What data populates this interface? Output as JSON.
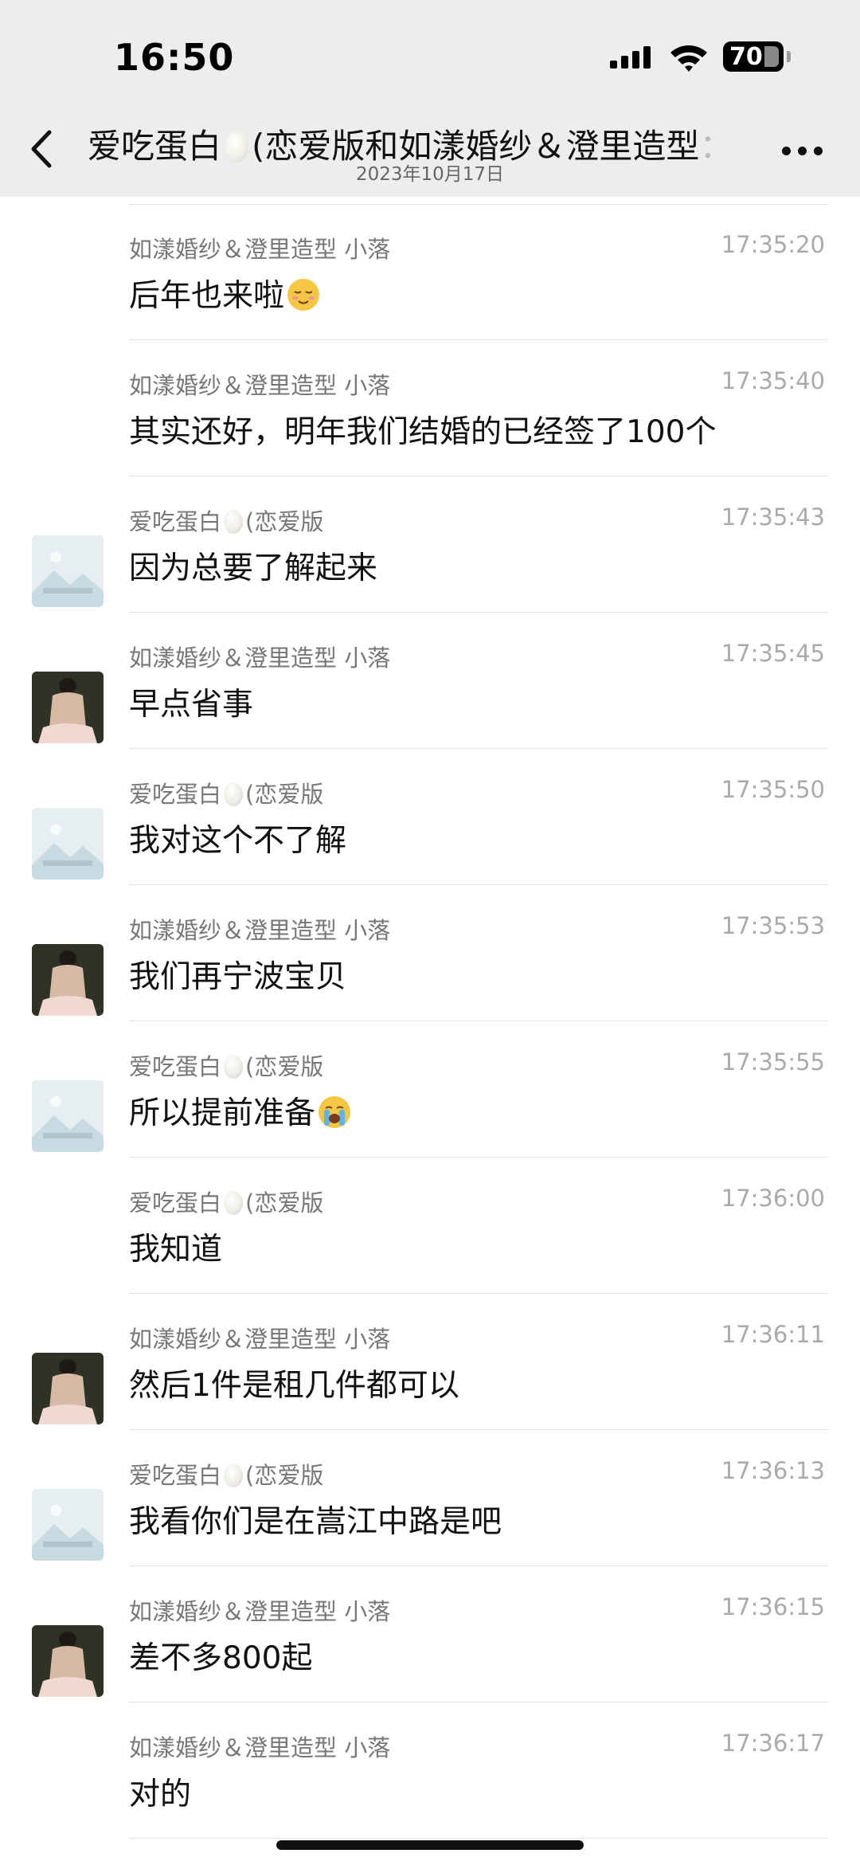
{
  "status_bar": {
    "time": "16:50",
    "battery": "70"
  },
  "header": {
    "title_pre": "爱吃蛋白",
    "title_post": "(恋爱版和如漾婚纱＆澄里造型",
    "title_cut": "：",
    "date": "2023年10月17日",
    "back_icon": "chevron-left-icon",
    "more_icon": "ellipsis-icon"
  },
  "names": {
    "me": "如漾婚纱＆澄里造型 小落",
    "her": "(恋爱版",
    "her_pre": "爱吃蛋白"
  },
  "messages": [
    {
      "sender": "me",
      "time": "17:35:20",
      "text": "后年也来啦",
      "emoji": "embarrassed-smile-emoji",
      "avatar": "none"
    },
    {
      "sender": "me",
      "time": "17:35:40",
      "text": "其实还好，明年我们结婚的已经签了100个",
      "avatar": "none"
    },
    {
      "sender": "her",
      "time": "17:35:43",
      "text": "因为总要了解起来",
      "avatar": "placeholder"
    },
    {
      "sender": "me",
      "time": "17:35:45",
      "text": "早点省事",
      "avatar": "photo"
    },
    {
      "sender": "her",
      "time": "17:35:50",
      "text": "我对这个不了解",
      "avatar": "placeholder"
    },
    {
      "sender": "me",
      "time": "17:35:53",
      "text": "我们再宁波宝贝",
      "avatar": "photo"
    },
    {
      "sender": "her",
      "time": "17:35:55",
      "text": "所以提前准备",
      "emoji": "crying-emoji",
      "avatar": "placeholder"
    },
    {
      "sender": "her",
      "time": "17:36:00",
      "text": "我知道",
      "avatar": "none"
    },
    {
      "sender": "me",
      "time": "17:36:11",
      "text": "然后1件是租几件都可以",
      "avatar": "photo"
    },
    {
      "sender": "her",
      "time": "17:36:13",
      "text": "我看你们是在嵩江中路是吧",
      "avatar": "placeholder"
    },
    {
      "sender": "me",
      "time": "17:36:15",
      "text": "差不多800起",
      "avatar": "photo"
    },
    {
      "sender": "me",
      "time": "17:36:17",
      "text": "对的",
      "avatar": "none"
    }
  ],
  "colors": {
    "header_bg": "#ededed",
    "name": "#777777",
    "time": "#aaaaaa",
    "text": "#111111",
    "divider": "#e2e2e2"
  }
}
